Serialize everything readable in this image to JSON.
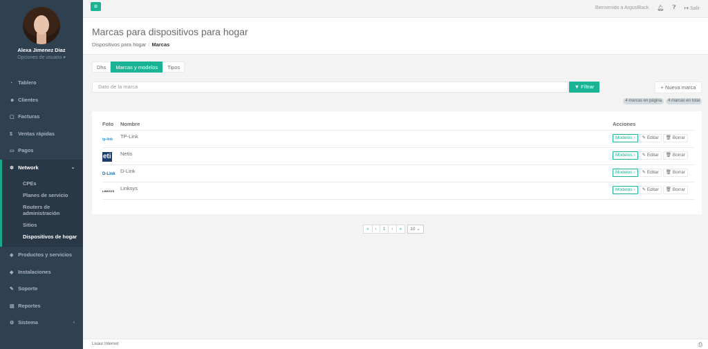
{
  "sidebar": {
    "user_name": "Alexa Jimenez Diaz",
    "user_options": "Opciones de usuario ▾",
    "items": [
      {
        "label": "Tablero",
        "icon": "dashboard-icon"
      },
      {
        "label": "Clientes",
        "icon": "users-icon"
      },
      {
        "label": "Facturas",
        "icon": "invoice-icon"
      },
      {
        "label": "Ventas rápidas",
        "icon": "dollar-icon"
      },
      {
        "label": "Pagos",
        "icon": "payment-icon"
      },
      {
        "label": "Network",
        "icon": "network-icon"
      },
      {
        "label": "Productos y servicios",
        "icon": "tag-icon"
      },
      {
        "label": "Instalaciones",
        "icon": "install-icon"
      },
      {
        "label": "Soporte",
        "icon": "wrench-icon"
      },
      {
        "label": "Reportes",
        "icon": "reports-icon"
      },
      {
        "label": "Sistema",
        "icon": "cogs-icon"
      }
    ],
    "network_sub": [
      "CPEs",
      "Planes de servicio",
      "Routers de administración",
      "Sitios",
      "Dispositivos de hogar"
    ]
  },
  "topbar": {
    "menu_icon": "hamburger-icon",
    "welcome": "Bienvenido a ArgusBlack",
    "logout": "Salir"
  },
  "heading": {
    "title": "Marcas para dispositivos para hogar",
    "crumb_parent": "Dispositivos para hogar",
    "crumb_current": "Marcas"
  },
  "tabs": [
    "Dhs",
    "Marcas y modelos",
    "Tipos"
  ],
  "filter": {
    "placeholder": "Dato de la marca",
    "filter_label": "Filtrar",
    "new_label": "Nueva marca",
    "badge_page": "4 marcas en página",
    "badge_total": "4 marcas en total"
  },
  "table": {
    "headers": {
      "foto": "Foto",
      "nombre": "Nombre",
      "acciones": "Acciones"
    },
    "rows": [
      {
        "logo": "tp-link",
        "name": "TP-Link"
      },
      {
        "logo": "eti",
        "name": "Netis"
      },
      {
        "logo": "D-Link",
        "name": "D-Link"
      },
      {
        "logo": "LINKSYS",
        "name": "Linksys"
      }
    ],
    "btn_models": "Modelos ›",
    "btn_edit": "Editar",
    "btn_delete": "Borrar"
  },
  "pager": {
    "first": "«",
    "prev": "‹",
    "page": "1",
    "next": "›",
    "last": "»",
    "size": "10"
  },
  "footer": {
    "text": "Livaur Internet"
  },
  "colors": {
    "accent": "#1ab394",
    "sidebar": "#2f4050"
  }
}
